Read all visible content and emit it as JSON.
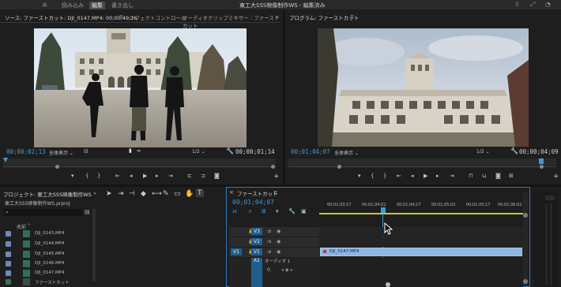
{
  "titlebar": {
    "tabs": [
      "読み込み",
      "編集",
      "書き出し"
    ],
    "active_tab": "編集",
    "window_title": "東工大SSS映像制作WS - 編集済み"
  },
  "source_panel": {
    "tab_source": "ソース: ファーストカット: DJI_0147.MP4: 00;00;49;26",
    "tab_source_menu": "≡",
    "tab_effects": "エフェクトコントロール",
    "tab_audio_mixer": "オーディオクリップミキサー : ファーストカット",
    "more": "»",
    "timecode_current": "00;00;02;13",
    "zoom": "全体表示",
    "resolution": "1/2",
    "timecode_duration": "00;00;01;14"
  },
  "program_panel": {
    "title": "プログラム: ファーストカット",
    "menu": "≡",
    "timecode_current": "00;01;04;07",
    "zoom": "全体表示",
    "resolution": "1/2",
    "timecode_duration": "00;00;04;09"
  },
  "project_panel": {
    "tab_title": "プロジェクト: 東工大SSS映像制作WS",
    "more": "»",
    "project_file": "東工大SSS映像制作WS.prproj",
    "column_name": "名前",
    "items": [
      "DJI_0143.MP4",
      "DJI_0144.MP4",
      "DJI_0145.MP4",
      "DJI_0146.MP4",
      "DJI_0147.MP4",
      "ファーストカット"
    ]
  },
  "timeline": {
    "title": "ファーストカット",
    "menu": "≡",
    "timecode": "00;01;04;07",
    "ruler": [
      "00;01;03;17",
      "00;01;04;02",
      "00;01;04;17",
      "00;01;05;02",
      "00;01;05;17",
      "00;01;06;02"
    ],
    "tracks": [
      {
        "target": "",
        "name": "V3"
      },
      {
        "target": "",
        "name": "V2"
      },
      {
        "target": "V1",
        "name": "V1"
      },
      {
        "target": "",
        "name": "A1"
      }
    ],
    "audio_track_label": "オーディオ 1",
    "audio_level": "0.",
    "clip_label": "DJI_0147.MP4"
  }
}
